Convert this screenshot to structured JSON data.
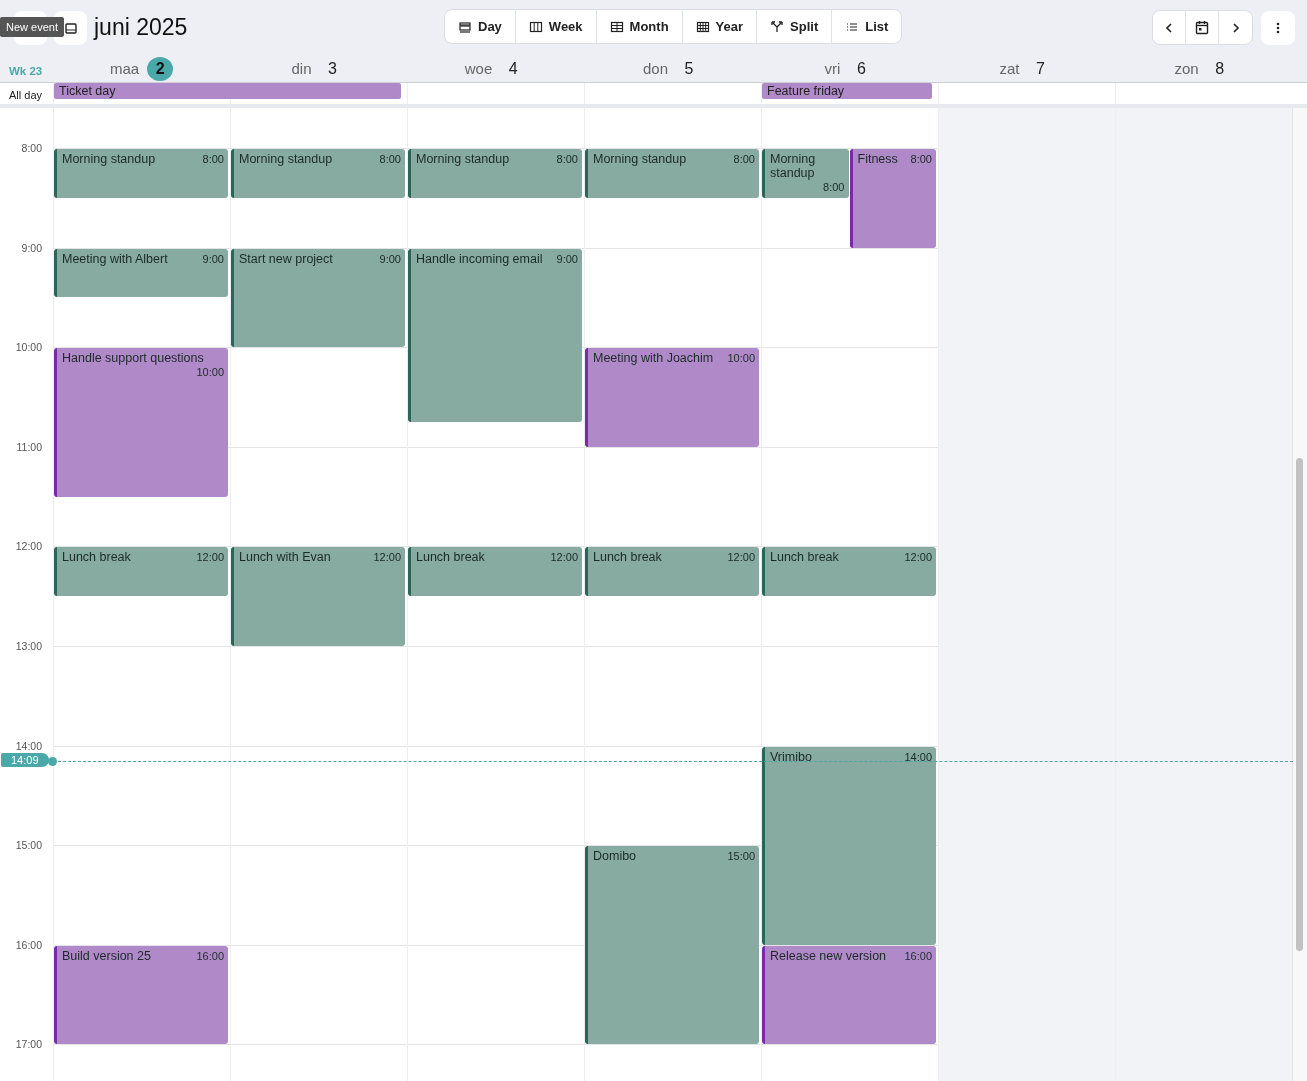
{
  "header": {
    "title": "juni 2025",
    "tooltip": "New event"
  },
  "views": [
    {
      "label": "Day",
      "selected": false
    },
    {
      "label": "Week",
      "selected": false
    },
    {
      "label": "Month",
      "selected": false
    },
    {
      "label": "Year",
      "selected": false
    },
    {
      "label": "Split",
      "selected": false
    },
    {
      "label": "List",
      "selected": false
    }
  ],
  "week_label": "Wk 23",
  "all_day_label": "All day",
  "now": "14:09",
  "hours": [
    "8:00",
    "9:00",
    "10:00",
    "11:00",
    "12:00",
    "13:00",
    "14:00",
    "15:00",
    "16:00",
    "17:00"
  ],
  "days": [
    {
      "name": "maa",
      "date": "2",
      "today": true,
      "weekend": false,
      "all_day": [
        {
          "title": "Ticket day",
          "color": "#b08ac8"
        }
      ],
      "events": [
        {
          "title": "Morning standup",
          "time": "8:00",
          "color": "#87aaa1"
        },
        {
          "title": "Meeting with Albert",
          "time": "9:00",
          "color": "#87aaa1"
        },
        {
          "title": "Handle support questions",
          "time": "10:00",
          "color": "#b08ac8"
        },
        {
          "title": "Lunch break",
          "time": "12:00",
          "color": "#87aaa1"
        },
        {
          "title": "Build version 25",
          "time": "16:00",
          "color": "#b08ac8"
        }
      ]
    },
    {
      "name": "din",
      "date": "3",
      "today": false,
      "weekend": false,
      "events": [
        {
          "title": "Morning standup",
          "time": "8:00",
          "color": "#87aaa1"
        },
        {
          "title": "Start new project",
          "time": "9:00",
          "color": "#87aaa1"
        },
        {
          "title": "Lunch with Evan",
          "time": "12:00",
          "color": "#87aaa1"
        }
      ]
    },
    {
      "name": "woe",
      "date": "4",
      "today": false,
      "weekend": false,
      "events": [
        {
          "title": "Morning standup",
          "time": "8:00",
          "color": "#87aaa1"
        },
        {
          "title": "Handle incoming email",
          "time": "9:00",
          "color": "#87aaa1"
        },
        {
          "title": "Lunch break",
          "time": "12:00",
          "color": "#87aaa1"
        }
      ]
    },
    {
      "name": "don",
      "date": "5",
      "today": false,
      "weekend": false,
      "events": [
        {
          "title": "Morning standup",
          "time": "8:00",
          "color": "#87aaa1"
        },
        {
          "title": "Meeting with Joachim",
          "time": "10:00",
          "color": "#b08ac8"
        },
        {
          "title": "Lunch break",
          "time": "12:00",
          "color": "#87aaa1"
        },
        {
          "title": "Domibo",
          "time": "15:00",
          "color": "#87aaa1"
        }
      ]
    },
    {
      "name": "vri",
      "date": "6",
      "today": false,
      "weekend": false,
      "all_day": [
        {
          "title": "Feature friday",
          "color": "#b08ac8"
        }
      ],
      "events": [
        {
          "title": "Morning standup",
          "time": "8:00",
          "color": "#87aaa1"
        },
        {
          "title": "Fitness",
          "time": "8:00",
          "color": "#b08ac8"
        },
        {
          "title": "Lunch break",
          "time": "12:00",
          "color": "#87aaa1"
        },
        {
          "title": "Vrimibo",
          "time": "14:00",
          "color": "#87aaa1"
        },
        {
          "title": "Release new version",
          "time": "16:00",
          "color": "#b08ac8"
        }
      ]
    },
    {
      "name": "zat",
      "date": "7",
      "today": false,
      "weekend": true
    },
    {
      "name": "zon",
      "date": "8",
      "today": false,
      "weekend": true
    }
  ]
}
